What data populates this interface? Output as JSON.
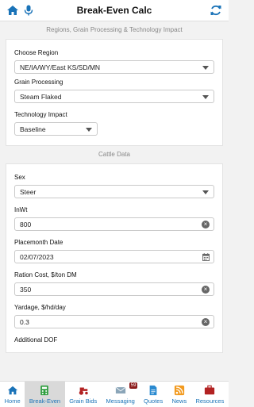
{
  "header": {
    "title": "Break-Even Calc"
  },
  "section1": {
    "title": "Regions, Grain Processing & Technology Impact",
    "region": {
      "label": "Choose Region",
      "value": "NE/IA/WY/East KS/SD/MN"
    },
    "grain": {
      "label": "Grain Processing",
      "value": "Steam Flaked"
    },
    "tech": {
      "label": "Technology Impact",
      "value": "Baseline"
    }
  },
  "section2": {
    "title": "Cattle Data",
    "sex": {
      "label": "Sex",
      "value": "Steer"
    },
    "inwt": {
      "label": "InWt",
      "value": "800"
    },
    "placement": {
      "label": "Placemonth Date",
      "value": "02/07/2023"
    },
    "ration": {
      "label": "Ration Cost, $/ton DM",
      "value": "350"
    },
    "yardage": {
      "label": "Yardage, $/hd/day",
      "value": "0.3"
    },
    "additional": {
      "label": "Additional DOF"
    }
  },
  "nav": {
    "home": "Home",
    "breakeven": "Break-Even",
    "grainbids": "Grain Bids",
    "messaging": "Messaging",
    "messaging_badge": "59",
    "quotes": "Quotes",
    "news": "News",
    "resources": "Resources"
  },
  "colors": {
    "accent": "#1a73b8",
    "green": "#2e9e3e",
    "badge": "#8b1a1a"
  }
}
